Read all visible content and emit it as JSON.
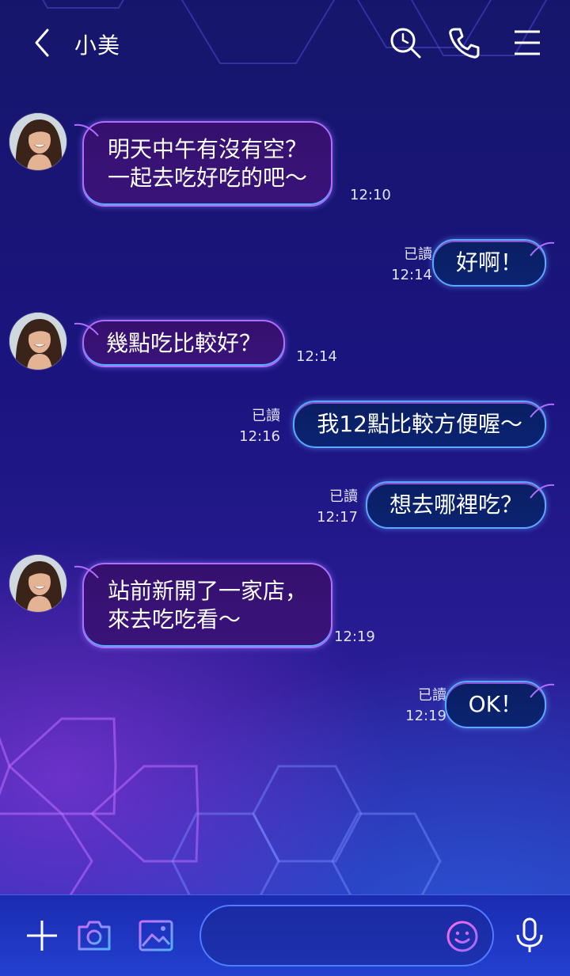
{
  "header": {
    "title": "小美",
    "icons": [
      "back-icon",
      "search-icon",
      "phone-icon",
      "menu-icon"
    ]
  },
  "messages": [
    {
      "dir": "in",
      "lines": [
        "明天中午有沒有空？",
        "一起去吃好吃的吧～"
      ],
      "time": "12:10"
    },
    {
      "dir": "out",
      "text": "好啊！",
      "read": "已讀",
      "time": "12:14"
    },
    {
      "dir": "in",
      "lines": [
        "幾點吃比較好？"
      ],
      "time": "12:14"
    },
    {
      "dir": "out",
      "text": "我12點比較方便喔～",
      "read": "已讀",
      "time": "12:16"
    },
    {
      "dir": "out",
      "text": "想去哪裡吃？",
      "read": "已讀",
      "time": "12:17"
    },
    {
      "dir": "in",
      "lines": [
        "站前新開了一家店，",
        "來去吃吃看～"
      ],
      "time": "12:19"
    },
    {
      "dir": "out",
      "text": "OK！",
      "read": "已讀",
      "time": "12:19"
    }
  ],
  "bottom_bar": {
    "icons": [
      "plus-icon",
      "camera-icon",
      "image-icon",
      "emoji-icon",
      "microphone-icon"
    ],
    "input_value": ""
  },
  "colors": {
    "incoming_border": "#b06cff",
    "outgoing_border": "#5aa8ff",
    "background_top": "#15166b",
    "background_bottom": "#2b37c4"
  }
}
